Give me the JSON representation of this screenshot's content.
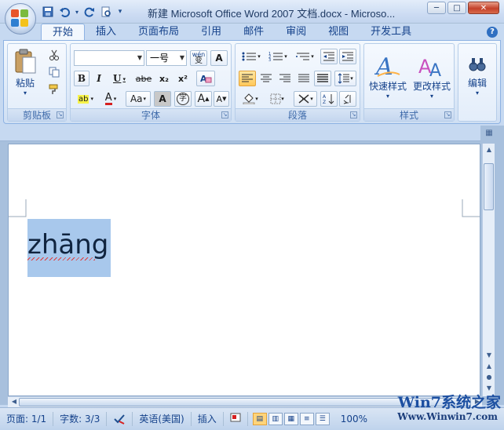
{
  "window": {
    "title": "新建 Microsoft Office Word 2007 文档.docx - Microso...",
    "minimize": "─",
    "maximize": "□",
    "close": "✕"
  },
  "quick_access": {
    "save_icon": "save-icon",
    "undo_icon": "undo-icon",
    "redo_icon": "redo-icon",
    "print_preview_icon": "print-preview-icon",
    "customize_icon": "customize-icon"
  },
  "tabs": [
    "开始",
    "插入",
    "页面布局",
    "引用",
    "邮件",
    "审阅",
    "视图",
    "开发工具"
  ],
  "active_tab": "开始",
  "ribbon": {
    "clipboard": {
      "label": "剪贴板",
      "paste": "粘贴"
    },
    "font": {
      "label": "字体",
      "font_name": "",
      "font_size": "一号",
      "wen": "wén\n变",
      "border_a": "A",
      "bold": "B",
      "italic": "I",
      "underline": "U",
      "strike": "abe",
      "subscript": "x₂",
      "superscript": "x²",
      "clear_format": "A",
      "highlight": "ab",
      "font_color": "A",
      "case": "Aa",
      "shade": "A",
      "enclose": "字",
      "grow": "A",
      "shrink": "A"
    },
    "paragraph": {
      "label": "段落"
    },
    "styles": {
      "label": "样式",
      "quick_styles": "快速样式",
      "change_styles": "更改样式"
    },
    "editing": {
      "label": "编辑"
    }
  },
  "document": {
    "text": "zhāng"
  },
  "status": {
    "page": "页面: 1/1",
    "words": "字数: 3/3",
    "language": "英语(美国)",
    "insert_mode": "插入",
    "zoom": "100%"
  },
  "watermark": {
    "line1": "Win7系统之家",
    "line2": "Www.Winwin7.com"
  },
  "colors": {
    "accent": "#15428b",
    "selection": "#a8c8ec",
    "ribbon": "#dde9f8",
    "active_align": "#ffc85a"
  }
}
